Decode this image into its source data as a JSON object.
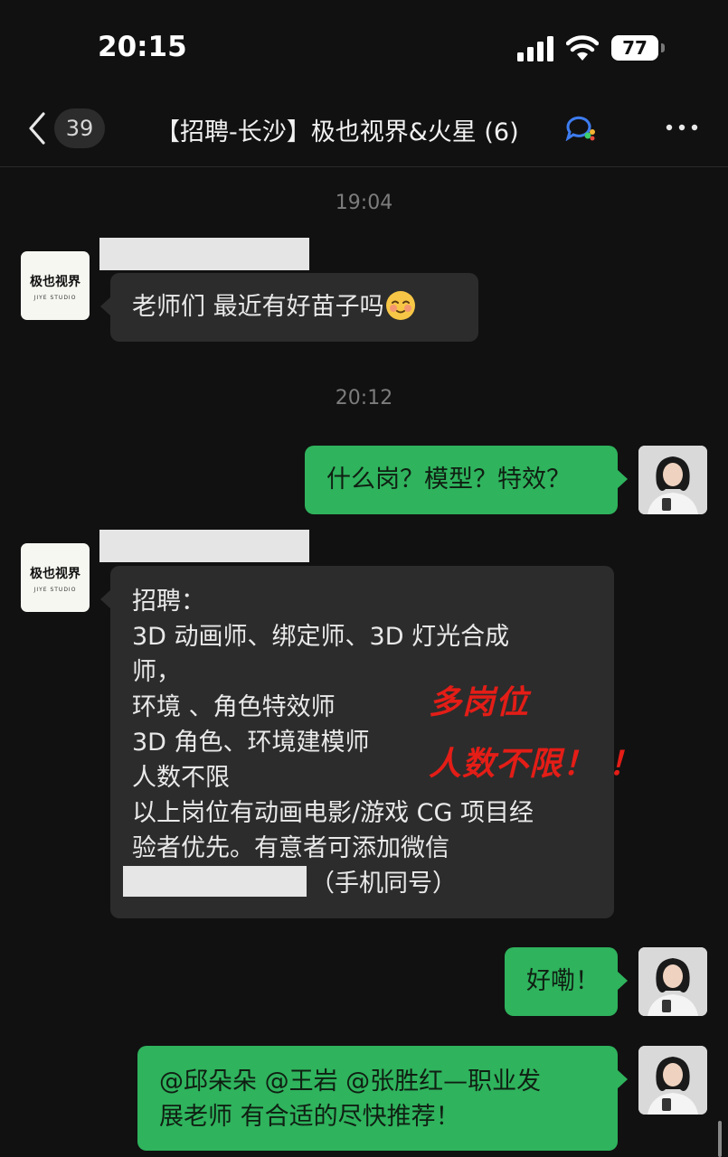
{
  "status": {
    "time": "20:15",
    "battery": "77"
  },
  "nav": {
    "unread_count": "39",
    "title": "【招聘-长沙】极也视界&火星 (6)"
  },
  "logo": {
    "line1": "极也视界",
    "line2": "JIYE STUDIO"
  },
  "messages": {
    "ts1": "19:04",
    "m1": "老师们 最近有好苗子吗",
    "ts2": "20:12",
    "m2": "什么岗？模型？特效？",
    "m3": {
      "l1": "招聘：",
      "l2": "3D 动画师、绑定师、3D 灯光合成",
      "l3": "师，",
      "l4": "环境 、角色特效师",
      "l5": "3D 角色、环境建模师",
      "l6": "人数不限",
      "l7": "以上岗位有动画电影/游戏 CG 项目经",
      "l8": "验者优先。有意者可添加微信",
      "l9": "（手机同号）"
    },
    "m4": "好嘞！",
    "m5": {
      "l1": "@邱朵朵 @王岩 @张胜红—职业发",
      "l2": "展老师 有合适的尽快推荐！"
    }
  },
  "overlay": {
    "a": "多岗位",
    "b": "人数不限！ ！"
  },
  "colors": {
    "background": "#111111",
    "incoming": "#2c2c2c",
    "outgoing": "#2fb35d",
    "overlay": "#e41d17"
  }
}
